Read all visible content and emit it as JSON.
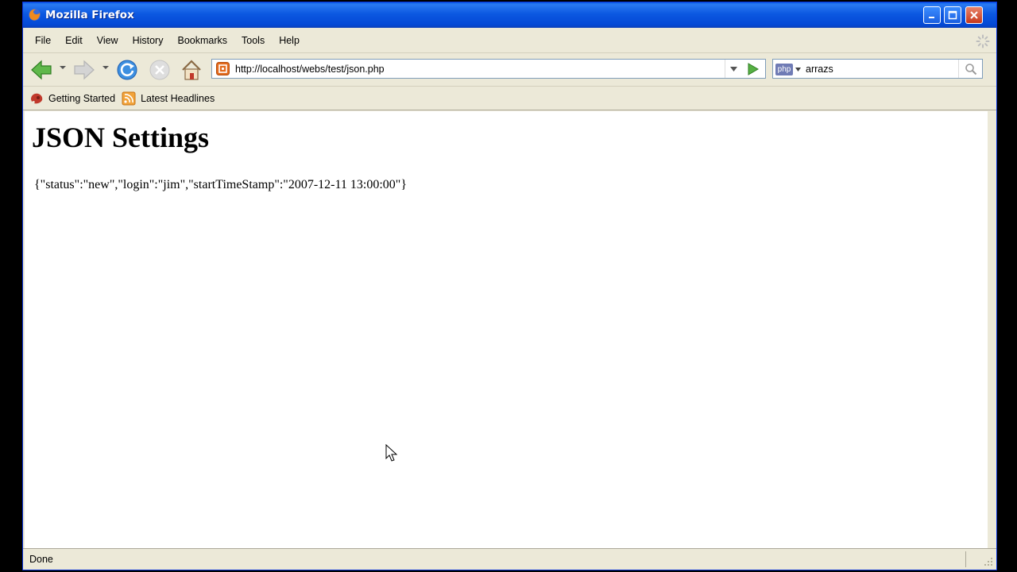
{
  "window": {
    "title": "Mozilla Firefox"
  },
  "menu": {
    "items": [
      {
        "label": "File",
        "access": "F"
      },
      {
        "label": "Edit",
        "access": "E"
      },
      {
        "label": "View",
        "access": "V"
      },
      {
        "label": "History",
        "access": "s"
      },
      {
        "label": "Bookmarks",
        "access": "B"
      },
      {
        "label": "Tools",
        "access": "T"
      },
      {
        "label": "Help",
        "access": "H"
      }
    ]
  },
  "navigation": {
    "url": "http://localhost/webs/test/json.php",
    "search_engine": "php",
    "search_query": "arrazs"
  },
  "bookmarks": {
    "items": [
      {
        "label": "Getting Started",
        "icon": "firefox-bookmark-icon"
      },
      {
        "label": "Latest Headlines",
        "icon": "rss-feed-icon"
      }
    ]
  },
  "page": {
    "heading": "JSON Settings",
    "body_text": "{\"status\":\"new\",\"login\":\"jim\",\"startTimeStamp\":\"2007-12-11 13:00:00\"}"
  },
  "status": {
    "text": "Done"
  },
  "colors": {
    "titlebar": "#0c58e1",
    "chrome": "#ece9d8",
    "close_button": "#c7391c"
  }
}
